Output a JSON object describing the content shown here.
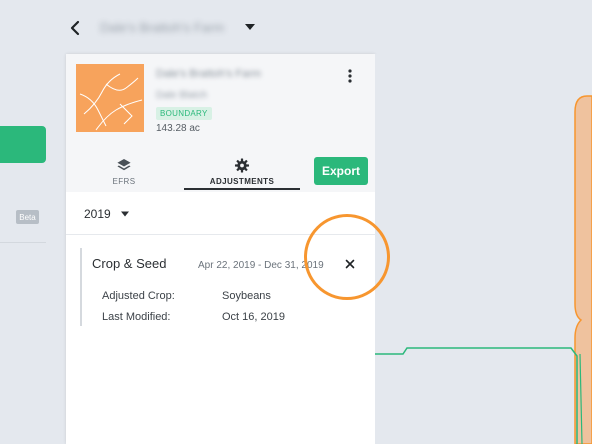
{
  "header": {
    "farm_title": "Dale's Brattoh's Farm"
  },
  "sidebar": {
    "beta_label": "Beta"
  },
  "field": {
    "name": "Dale's Brattoh's Farm",
    "subtitle": "Dale Blatch",
    "badge": "BOUNDARY",
    "acres": "143.28 ac"
  },
  "tabs": [
    {
      "label": "EFRS",
      "icon": "layers-icon",
      "active": false
    },
    {
      "label": "ADJUSTMENTS",
      "icon": "gear-icon",
      "active": true
    }
  ],
  "export_label": "Export",
  "year": {
    "selected": "2019"
  },
  "adjustment": {
    "title": "Crop & Seed",
    "dates": "Apr 22, 2019 - Dec 31, 2019",
    "rows": [
      {
        "label": "Adjusted Crop:",
        "value": "Soybeans"
      },
      {
        "label": "Last Modified:",
        "value": "Oct 16, 2019"
      }
    ]
  },
  "colors": {
    "accent": "#2bb87b",
    "boundary_fill": "#f7a35c",
    "highlight": "#f7962f",
    "background": "#e4e8ee"
  }
}
